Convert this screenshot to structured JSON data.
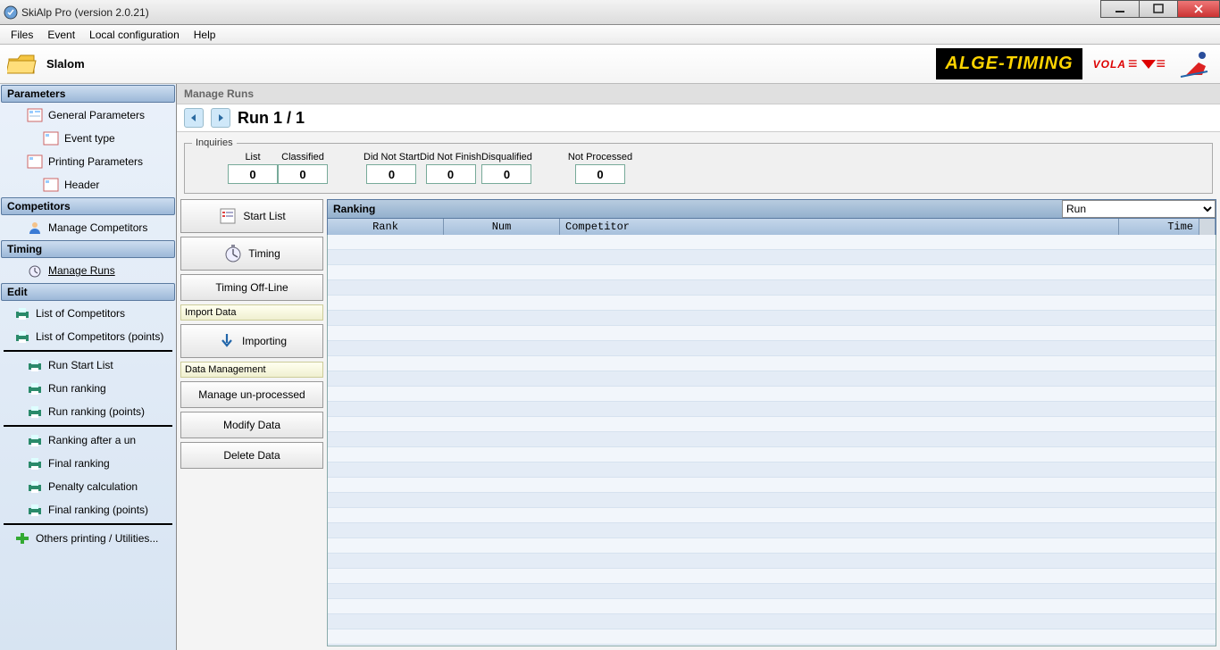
{
  "window": {
    "title": "SkiAlp Pro (version 2.0.21)"
  },
  "menu": {
    "files": "Files",
    "event": "Event",
    "local": "Local configuration",
    "help": "Help"
  },
  "banner": {
    "event_type": "Slalom",
    "alge": "ALGE-TIMING",
    "vola": "VOLA"
  },
  "sidebar": {
    "sections": {
      "parameters": "Parameters",
      "competitors": "Competitors",
      "timing": "Timing",
      "edit": "Edit"
    },
    "items": {
      "general_parameters": "General Parameters",
      "event_type": "Event type",
      "printing_parameters": "Printing Parameters",
      "header": "Header",
      "manage_competitors": "Manage Competitors",
      "manage_runs": "Manage Runs",
      "list_competitors": "List of Competitors",
      "list_competitors_points": "List of Competitors (points)",
      "run_start_list": "Run Start List",
      "run_ranking": "Run ranking",
      "run_ranking_points": "Run ranking (points)",
      "ranking_after_run": "Ranking after a un",
      "final_ranking": "Final ranking",
      "penalty_calculation": "Penalty calculation",
      "final_ranking_points": "Final ranking (points)",
      "others_printing": "Others printing / Utilities..."
    }
  },
  "content": {
    "crumb": "Manage Runs",
    "run_title": "Run 1 / 1",
    "inquiries": {
      "legend": "Inquiries",
      "labels": {
        "list": "List",
        "classified": "Classified",
        "dns": "Did Not Start",
        "dnf": "Did Not Finish",
        "dsq": "Disqualified",
        "np": "Not Processed"
      },
      "values": {
        "list": "0",
        "classified": "0",
        "dns": "0",
        "dnf": "0",
        "dsq": "0",
        "np": "0"
      }
    },
    "actions": {
      "start_list": "Start List",
      "timing": "Timing",
      "timing_offline": "Timing Off-Line",
      "import_group": "Import Data",
      "importing": "Importing",
      "data_group": "Data Management",
      "manage_unprocessed": "Manage un-processed",
      "modify_data": "Modify Data",
      "delete_data": "Delete Data"
    },
    "ranking": {
      "title": "Ranking",
      "dropdown": "Run",
      "cols": {
        "rank": "Rank",
        "num": "Num",
        "competitor": "Competitor",
        "time": "Time"
      }
    }
  }
}
